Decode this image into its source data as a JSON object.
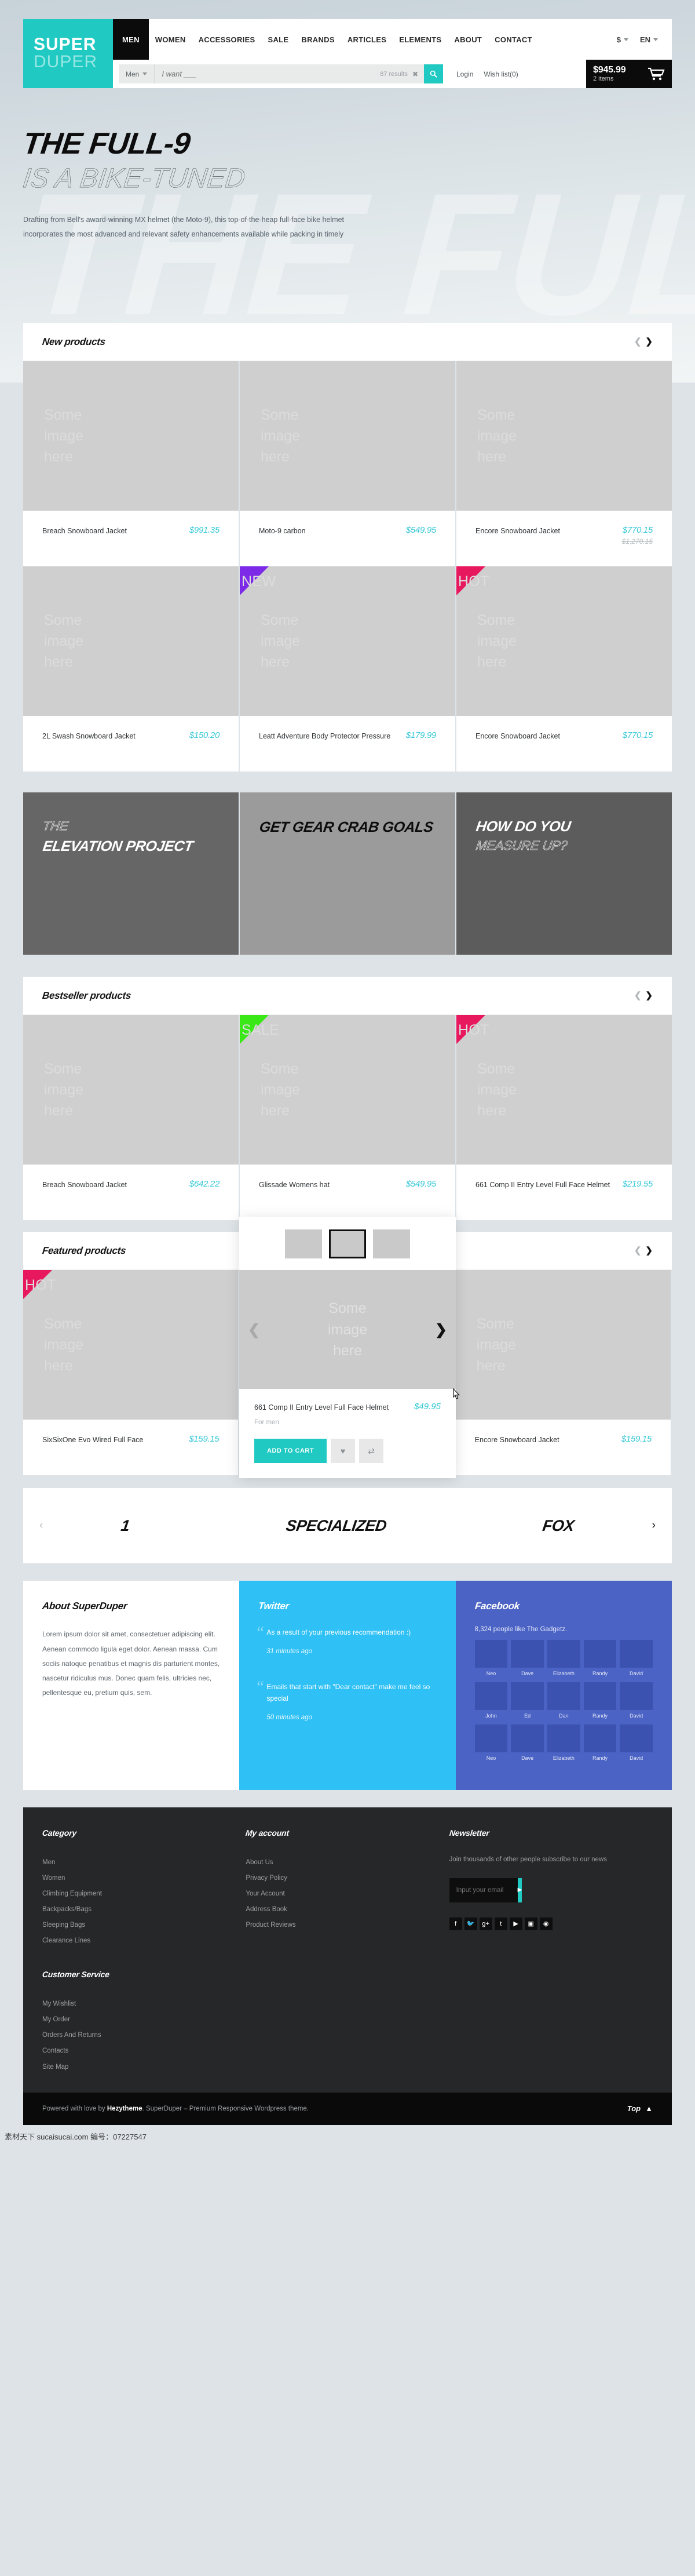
{
  "header": {
    "logo_line1": "SUPER",
    "logo_line2": "DUPER",
    "nav": [
      {
        "label": "MEN",
        "active": true
      },
      {
        "label": "WOMEN",
        "active": false
      },
      {
        "label": "ACCESSORIES",
        "active": false
      },
      {
        "label": "SALE",
        "active": false
      },
      {
        "label": "BRANDS",
        "active": false
      },
      {
        "label": "ARTICLES",
        "active": false
      },
      {
        "label": "ELEMENTS",
        "active": false
      },
      {
        "label": "ABOUT",
        "active": false
      },
      {
        "label": "CONTACT",
        "active": false
      }
    ],
    "currency": "$",
    "language": "EN",
    "search_category": "Men",
    "search_placeholder": "I want ___",
    "search_results": "87 results",
    "search_clear": "✖",
    "login": "Login",
    "wishlist": "Wish list(0)",
    "cart_price": "$945.99",
    "cart_items": "2 items"
  },
  "hero": {
    "line1": "THE FULL-9",
    "line2": "IS A BIKE-TUNED",
    "watermark": "THE FULL",
    "paragraph": "Drafting from Bell's award-winning MX helmet (the Moto-9), this top-of-the-heap full-face bike helmet incorporates the most advanced and relevant safety enhancements available while packing in timely"
  },
  "placeholder_image_text": "Some\nimage\nhere",
  "sections": {
    "new_products": {
      "title": "New products",
      "prev": "❮",
      "next": "❯",
      "rows": [
        [
          {
            "name": "Breach Snowboard Jacket",
            "price": "$991.35",
            "old_price": "",
            "badge": ""
          },
          {
            "name": "Moto-9 carbon",
            "price": "$549.95",
            "old_price": "",
            "badge": ""
          },
          {
            "name": "Encore Snowboard Jacket",
            "price": "$770.15",
            "old_price": "$1,270.15",
            "badge": ""
          }
        ],
        [
          {
            "name": "2L Swash Snowboard Jacket",
            "price": "$150.20",
            "old_price": "",
            "badge": ""
          },
          {
            "name": "Leatt Adventure Body Protector Pressure",
            "price": "$179.99",
            "old_price": "",
            "badge": "NEW"
          },
          {
            "name": "Encore Snowboard Jacket",
            "price": "$770.15",
            "old_price": "",
            "badge": "HOT"
          }
        ]
      ]
    },
    "banners": [
      {
        "thin": "THE",
        "bold": "ELEVATION PROJECT",
        "style": "light-on-dark"
      },
      {
        "thin": "",
        "bold": "GET GEAR CRAB GOALS",
        "style": "black-on-gray"
      },
      {
        "thin": "MEASURE UP?",
        "bold": "HOW DO YOU",
        "style": "white-on-dark"
      }
    ],
    "bestseller_products": {
      "title": "Bestseller products",
      "prev": "❮",
      "next": "❯",
      "items": [
        {
          "name": "Breach Snowboard Jacket",
          "price": "$642.22",
          "old_price": "",
          "badge": ""
        },
        {
          "name": "Glissade Womens hat",
          "price": "$549.95",
          "old_price": "",
          "badge": "SALE"
        },
        {
          "name": "661 Comp II Entry Level Full Face Helmet",
          "price": "$219.55",
          "old_price": "",
          "badge": "HOT"
        }
      ]
    },
    "featured_products": {
      "title": "Featured products",
      "prev": "❮",
      "next": "❯",
      "items": [
        {
          "name": "SixSixOne Evo Wired Full Face",
          "price": "$159.15",
          "old_price": "",
          "badge": "HOT"
        },
        {
          "name": "661 Comp II Entry Level Full Face Helmet",
          "price": "$49.95",
          "old_price": "",
          "badge": ""
        },
        {
          "name": "Encore Snowboard Jacket",
          "price": "$159.15",
          "old_price": "",
          "badge": ""
        }
      ]
    },
    "quickview": {
      "name": "661 Comp II Entry Level Full Face Helmet",
      "price": "$49.95",
      "subtitle": "For men",
      "add_to_cart": "ADD TO CART",
      "wishlist_icon": "♥",
      "compare_icon": "⇄",
      "prev": "❮",
      "next": "❯"
    },
    "brands": {
      "prev": "‹",
      "next": "›",
      "items": [
        "1",
        "SPECIALIZED",
        "FOX"
      ]
    }
  },
  "about": {
    "title": "About SuperDuper",
    "text": "Lorem ipsum dolor sit amet, consectetuer adipiscing elit. Aenean commodo ligula eget dolor. Aenean massa. Cum sociis natoque penatibus et magnis dis parturient montes, nascetur ridiculus mus. Donec quam felis, ultricies nec, pellentesque eu, pretium quis, sem."
  },
  "twitter": {
    "title": "Twitter",
    "tweets": [
      {
        "body": "As a result of your previous recommendation :)",
        "time": "31 minutes ago"
      },
      {
        "body": "Emails that start with \"Dear contact\" make me feel so special",
        "time": "50 minutes ago"
      }
    ]
  },
  "facebook": {
    "title": "Facebook",
    "likes": "8,324 people like The Gadgetz.",
    "rows": [
      [
        "Neo",
        "Dave",
        "Elizabeth",
        "Randy",
        "David"
      ],
      [
        "John",
        "Ed",
        "Dan",
        "Randy",
        "David"
      ],
      [
        "Neo",
        "Dave",
        "Elizabeth",
        "Randy",
        "David"
      ]
    ]
  },
  "footer": {
    "category": {
      "title": "Category",
      "links": [
        "Men",
        "Women",
        "Climbing Equipment",
        "Backpacks/Bags",
        "Sleeping Bags",
        "Clearance Lines"
      ]
    },
    "my_account": {
      "title": "My account",
      "links": [
        "About Us",
        "Privacy Policy",
        "Your Account",
        "Address Book",
        "Product Reviews"
      ]
    },
    "newsletter": {
      "title": "Newsletter",
      "note": "Join thousands of other people subscribe to our news",
      "placeholder": "Input your email",
      "submit_icon": "▶",
      "socials": [
        "f",
        "🐦",
        "g+",
        "t",
        "▶",
        "▣",
        "◉"
      ]
    },
    "customer_service": {
      "title": "Customer Service",
      "links": [
        "My Wishlist",
        "My Order",
        "Orders And Returns",
        "Contacts",
        "Site Map"
      ]
    },
    "bottom_text_pre": "Powered with love by ",
    "bottom_brand": "Hezytheme",
    "bottom_text_post": ". SuperDuper – Premium Responsive Wordpress theme.",
    "top_label": "Top",
    "top_icon": "▲"
  },
  "watermark_bottom": "素材天下 sucaisucai.com 编号：07227547",
  "colors": {
    "accent": "#20c9c2",
    "price": "#36c8d8",
    "hot": "#e8185f",
    "new": "#7d2ae8",
    "sale": "#3ae817",
    "twitter": "#2fc0f5",
    "facebook": "#4b63c4",
    "footer": "#262729"
  }
}
